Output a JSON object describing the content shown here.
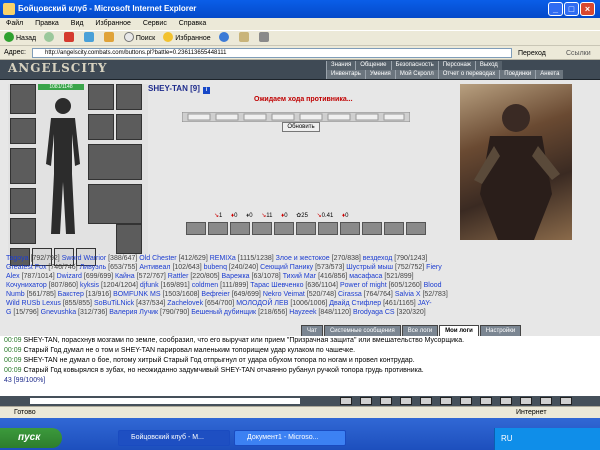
{
  "window": {
    "title": "Бойцовский клуб - Microsoft Internet Explorer"
  },
  "menu": [
    "Файл",
    "Правка",
    "Вид",
    "Избранное",
    "Сервис",
    "Справка"
  ],
  "toolbar": {
    "back": "Назад",
    "search": "Поиск",
    "favorites": "Избранное"
  },
  "address": {
    "label": "Адрес:",
    "url": "http://angelscity.combats.com/buttons.pl?battle=0.236113655448111",
    "go": "Переход",
    "links": "Ссылки"
  },
  "game": {
    "logo": "ANGELSCITY",
    "nav_top": [
      "Знания",
      "Общение",
      "Безопасность",
      "Персонаж",
      "Выход"
    ],
    "nav_bottom": [
      "Инвентарь",
      "Умения",
      "Мой Скролл",
      "Отчет о переводах",
      "Поединки",
      "Анкета"
    ],
    "hp_text": "1081/1148",
    "char_name": "SHEY-TAN",
    "char_level": "[9]",
    "info_label": "i",
    "waiting": "Ожидаем хода противника...",
    "refresh": "Обновить",
    "stats": [
      "1",
      "0",
      "0",
      "11",
      "0",
      "25",
      "0.41",
      "0"
    ]
  },
  "participants": [
    [
      "Tagoya",
      "[792/792]",
      "Sword Warrior",
      "[388/647]",
      "Old Chester",
      "[412/629]",
      "REMIXa",
      "[1115/1238]",
      "Злое и жестокое",
      "[270/838]",
      "вездеход",
      "[790/1243]"
    ],
    [
      "Greatest Fox",
      "[746/746]",
      "Ливуэль",
      "[653/755]",
      "Антивеал",
      "[102/643]",
      "bubenq",
      "[240/240]",
      "Сеющий Панику",
      "[573/573]",
      "Шустрый мыш",
      "[752/752]",
      "Fiery"
    ],
    [
      "Alex",
      "[787/1014]",
      "Dwizard",
      "[699/699]",
      "Кайна",
      "[572/767]",
      "Rattler",
      "[220/805]",
      "Варежка",
      "[63/1078]",
      "Тихий Маг",
      "[416/856]",
      "масафаса",
      "[521/899]"
    ],
    [
      "Кочунихатор",
      "[807/860]",
      "kyksis",
      "[1204/1204]",
      "djfunk",
      "[169/891]",
      "coldmen",
      "[111/899]",
      "Тарас Шевченко",
      "[636/1104]",
      "Power of might",
      "[605/1260]",
      "Blood"
    ],
    [
      "Numb",
      "[561/785]",
      "Бакстер",
      "[13/916]",
      "BOMFUNK MS",
      "[1503/1608]",
      "Beфreier",
      "[649/699]",
      "Nekro Veimat",
      "[520/748]",
      "Cirassa",
      "[764/764]",
      "Salvia X",
      "[52/783]"
    ],
    [
      "Wild RUSb Lexus",
      "[855/855]",
      "SoBuTiLNick",
      "[437/534]",
      "Zachelovek",
      "[654/700]",
      "МОЛОДОЙ ЛЕВ",
      "[1006/1006]",
      "Двайд Стифлер",
      "[461/1165]",
      "JAY-"
    ],
    [
      "G",
      "[15/796]",
      "Gnevushka",
      "[312/736]",
      "Валерия Лучик",
      "[790/790]",
      "Бешеный дубинщик",
      "[218/656]",
      "Hayzeek",
      "[848/1120]",
      "Brodyaga CS",
      "[320/320]"
    ]
  ],
  "tabs": [
    "Чат",
    "Системные сообщения",
    "Все логи",
    "Мои логи",
    "Настройки"
  ],
  "chat": [
    {
      "time": "00:09",
      "text": "SHEY-TAN, порасхнув мозгами по земле, сообразил, что его выручат или прием \"Призрачная защита\" или вмешательство Мусорщика."
    },
    {
      "time": "00:09",
      "text": "Старый Год думал не о том и SHEY-TAN парировал маленьким топорищем удар кулаком по чашечке."
    },
    {
      "time": "00:09",
      "text": "SHEY-TAN не думал о бое, потому хитрый Старый Год отпрыгнул от удара обухом топора по ногам и провел контрудар."
    },
    {
      "time": "00:09",
      "text": "Старый Год ковырялся в зубах, но неожиданно задумчивый SHEY-TAN отчаянно рубанул ручкой топора грудь противника."
    }
  ],
  "chat_count": "43 [99/100%]",
  "status": {
    "left": "Готово",
    "right": "Интернет"
  },
  "taskbar": {
    "start": "пуск",
    "tasks": [
      "Бойцовский клуб - M...",
      "Документ1 - Microso..."
    ],
    "lang": "RU"
  }
}
